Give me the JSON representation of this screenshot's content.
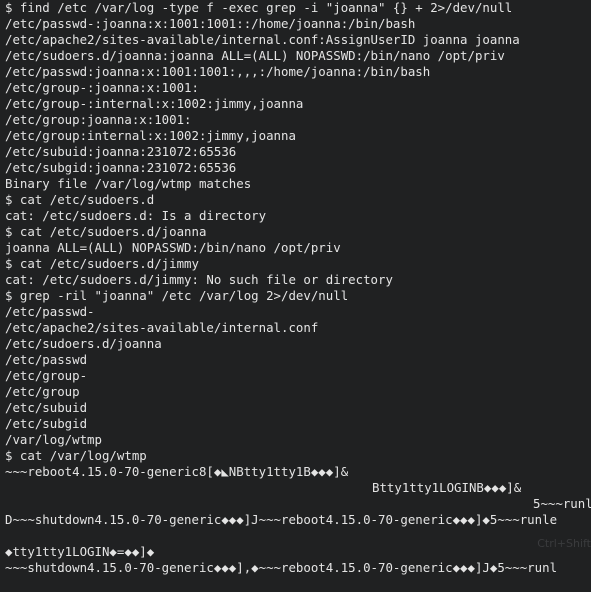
{
  "terminal": {
    "lines": [
      "$ find /etc /var/log -type f -exec grep -i \"joanna\" {} + 2>/dev/null",
      "/etc/passwd-:joanna:x:1001:1001::/home/joanna:/bin/bash",
      "/etc/apache2/sites-available/internal.conf:AssignUserID joanna joanna",
      "/etc/sudoers.d/joanna:joanna ALL=(ALL) NOPASSWD:/bin/nano /opt/priv",
      "/etc/passwd:joanna:x:1001:1001:,,,:/home/joanna:/bin/bash",
      "/etc/group-:joanna:x:1001:",
      "/etc/group-:internal:x:1002:jimmy,joanna",
      "/etc/group:joanna:x:1001:",
      "/etc/group:internal:x:1002:jimmy,joanna",
      "/etc/subuid:joanna:231072:65536",
      "/etc/subgid:joanna:231072:65536",
      "Binary file /var/log/wtmp matches",
      "$ cat /etc/sudoers.d",
      "cat: /etc/sudoers.d: Is a directory",
      "$ cat /etc/sudoers.d/joanna",
      "joanna ALL=(ALL) NOPASSWD:/bin/nano /opt/priv",
      "$ cat /etc/sudoers.d/jimmy",
      "cat: /etc/sudoers.d/jimmy: No such file or directory",
      "$ grep -ril \"joanna\" /etc /var/log 2>/dev/null",
      "/etc/passwd-",
      "/etc/apache2/sites-available/internal.conf",
      "/etc/sudoers.d/joanna",
      "/etc/passwd",
      "/etc/group-",
      "/etc/group",
      "/etc/subuid",
      "/etc/subgid",
      "/var/log/wtmp",
      "$ cat /var/log/wtmp",
      "~~~reboot4.15.0-70-generic8[◆◣NBtty1tty1B◆◆◆]&",
      "Btty1tty1LOGINB◆◆◆]&",
      "5~~~runl",
      "D~~~shutdown4.15.0-70-generic◆◆◆]J~~~reboot4.15.0-70-generic◆◆◆]◆5~~~runle",
      "",
      "◆tty1tty1LOGIN◆=◆◆]◆",
      "~~~shutdown4.15.0-70-generic◆◆◆],◆~~~reboot4.15.0-70-generic◆◆◆]J◆5~~~runl"
    ],
    "watermark": "Ctrl+Shift"
  }
}
